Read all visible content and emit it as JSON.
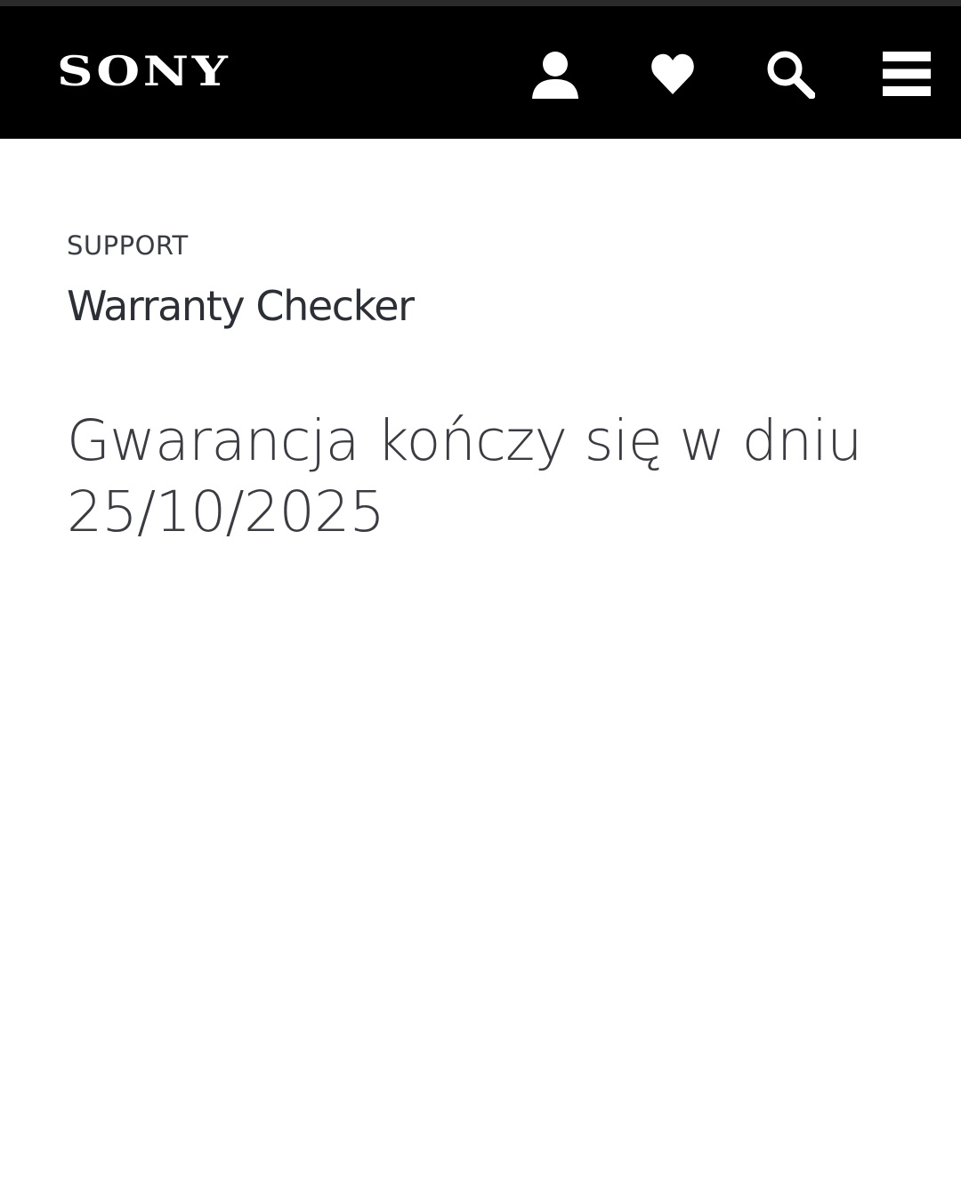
{
  "header": {
    "logo_text": "SONY",
    "background": "#000000",
    "icons": [
      {
        "name": "account-icon",
        "label": "Account"
      },
      {
        "name": "heart-icon",
        "label": "Wishlist"
      },
      {
        "name": "search-icon",
        "label": "Search"
      },
      {
        "name": "menu-icon",
        "label": "Menu"
      }
    ]
  },
  "main": {
    "eyebrow": "SUPPORT",
    "title": "Warranty Checker",
    "result_line1": "Gwarancja kończy się w dniu",
    "result_line2": "25/10/2025"
  },
  "colors": {
    "text_primary": "#2c2f36",
    "text_secondary": "#3a3d44",
    "header_bg": "#000000",
    "page_bg": "#ffffff"
  }
}
